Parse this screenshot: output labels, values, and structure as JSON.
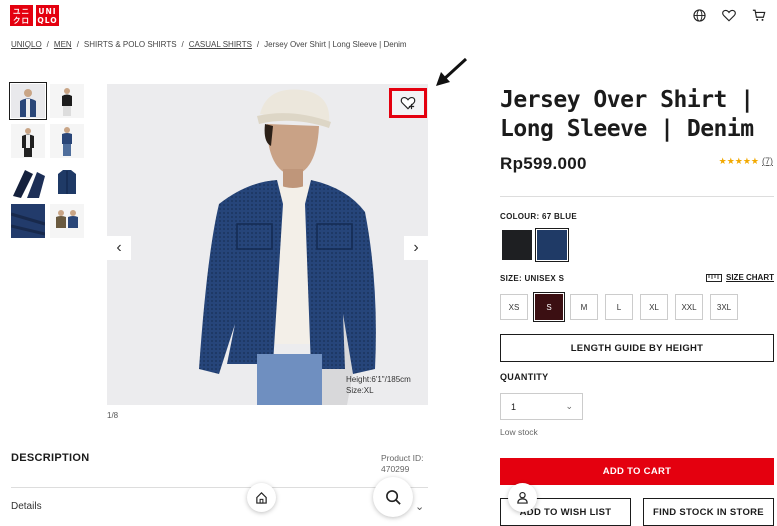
{
  "brand": {
    "logo_left": "ユニ\nクロ",
    "logo_right": "UNI\nQLO",
    "color": "#e4000f"
  },
  "header_icons": [
    "globe-icon",
    "heart-icon",
    "cart-icon"
  ],
  "breadcrumb": {
    "items": [
      "UNIQLO",
      "MEN",
      "SHIRTS & POLO SHIRTS",
      "CASUAL SHIRTS"
    ],
    "current": "Jersey Over Shirt | Long Sleeve | Denim",
    "separator": "/"
  },
  "gallery": {
    "pager": "1/8",
    "model_info": [
      "Height:6'1\"/185cm",
      "Size:XL"
    ],
    "prev_label": "‹",
    "next_label": "›"
  },
  "description": {
    "heading": "DESCRIPTION",
    "product_id_label": "Product ID:",
    "product_id": "470299",
    "details_label": "Details"
  },
  "product": {
    "title": "Jersey Over Shirt | Long Sleeve | Denim",
    "price": "Rp599.000",
    "stars": "★★★★★",
    "review_count": "(7)"
  },
  "colour": {
    "label": "COLOUR: 67 BLUE",
    "options": [
      {
        "name": "black",
        "hex": "#1e1f22"
      },
      {
        "name": "blue",
        "hex": "#1f3a66"
      }
    ],
    "selected": "blue"
  },
  "size": {
    "label": "SIZE: UNISEX S",
    "chart_label": "SIZE CHART",
    "options": [
      "XS",
      "S",
      "M",
      "L",
      "XL",
      "XXL",
      "3XL"
    ],
    "selected": "S"
  },
  "length_guide_label": "LENGTH GUIDE BY HEIGHT",
  "quantity": {
    "label": "QUANTITY",
    "value": "1",
    "stock": "Low stock"
  },
  "actions": {
    "add_to_cart": "ADD TO CART",
    "wish_list": "ADD TO WISH LIST",
    "find_stock": "FIND STOCK IN STORE"
  }
}
